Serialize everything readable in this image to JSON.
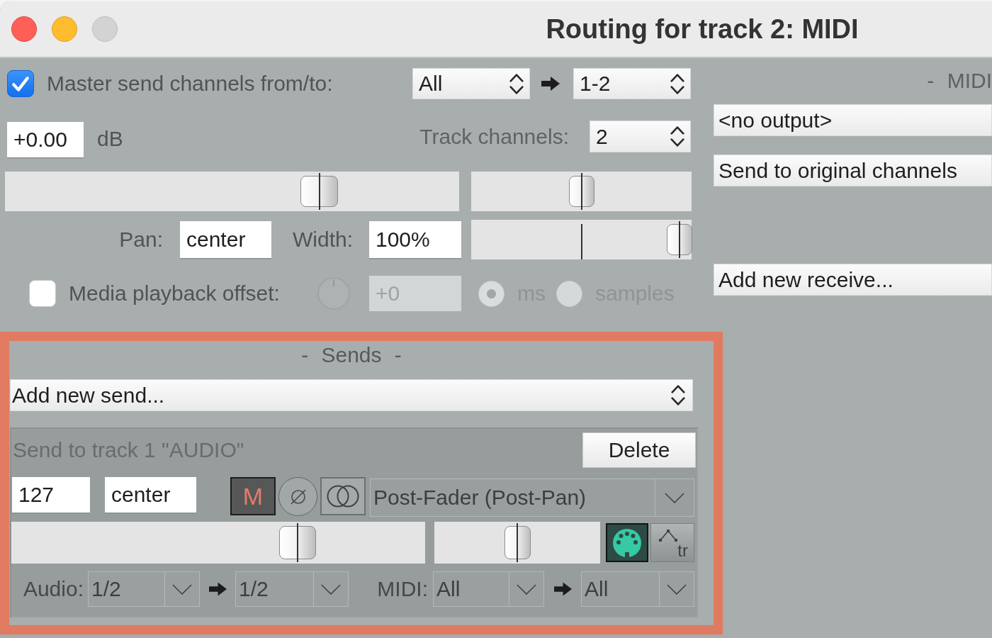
{
  "window": {
    "title": "Routing for track 2: MIDI"
  },
  "master_send": {
    "checked": true,
    "label": "Master send channels from/to:",
    "from": "All",
    "to": "1-2"
  },
  "volume": {
    "value": "+0.00",
    "unit": "dB",
    "level": 0.71
  },
  "track_channels": {
    "label": "Track channels:",
    "value": "2"
  },
  "pan": {
    "label": "Pan:",
    "value": "center",
    "level": 0.5
  },
  "width": {
    "label": "Width:",
    "value": "100%",
    "level": 1.0
  },
  "media_offset": {
    "checked": false,
    "disabled": true,
    "label": "Media playback offset:",
    "value": "+0",
    "units": [
      {
        "label": "ms",
        "selected": true
      },
      {
        "label": "samples",
        "selected": false
      }
    ]
  },
  "sends": {
    "highlighted": true,
    "heading": "- Sends -",
    "add_send": "Add new send...",
    "items": [
      {
        "title": "Send to track 1 \"AUDIO\"",
        "delete": "Delete",
        "volume": "127",
        "pan": "center",
        "mute": {
          "label": "M",
          "on": true
        },
        "phase_invert": {
          "on": false
        },
        "mono": {
          "on": false
        },
        "mode": "Post-Fader (Post-Pan)",
        "volume_fader": {
          "level": 0.71
        },
        "pan_fader": {
          "level": 0.5
        },
        "midi_toggle": {
          "on": true
        },
        "envelope": {
          "label": "tr"
        },
        "audio_channels": {
          "label": "Audio:",
          "from": "1/2",
          "to": "1/2"
        },
        "midi_channels": {
          "label": "MIDI:",
          "from": "All",
          "to": "All"
        }
      }
    ]
  },
  "midi_output": {
    "heading": "- MIDI",
    "device": "<no output>",
    "channel_mode": "Send to original channels",
    "add_receive": "Add new receive..."
  }
}
